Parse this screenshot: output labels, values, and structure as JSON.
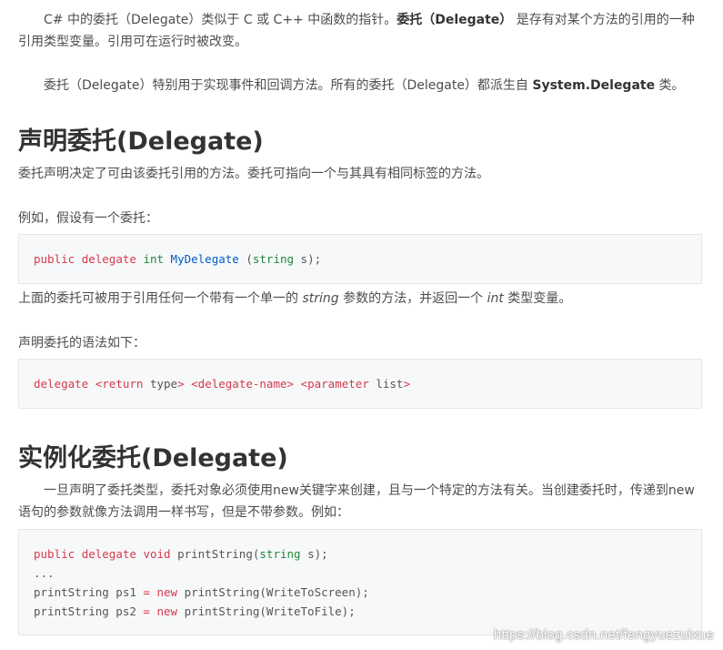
{
  "intro": {
    "p1_a": "C# 中的委托（Delegate）类似于 C 或 C++ 中函数的指针。",
    "p1_bold": "委托（Delegate）",
    "p1_b": " 是存有对某个方法的引用的一种引用类型变量。引用可在运行时被改变。",
    "p2_a": "委托（Delegate）特别用于实现事件和回调方法。所有的委托（Delegate）都派生自 ",
    "p2_bold": "System.Delegate",
    "p2_b": " 类。"
  },
  "declare": {
    "heading": "声明委托(Delegate)",
    "desc": "委托声明决定了可由该委托引用的方法。委托可指向一个与其具有相同标签的方法。",
    "example_intro": "例如，假设有一个委托：",
    "code1": {
      "public": "public",
      "delegate": "delegate",
      "int": "int",
      "name": "MyDelegate",
      "open": " (",
      "string": "string",
      "rest": " s);"
    },
    "above_a": "上面的委托可被用于引用任何一个带有一个单一的 ",
    "above_string": "string",
    "above_b": " 参数的方法，并返回一个 ",
    "above_int": "int",
    "above_c": " 类型变量。",
    "syntax_intro": "声明委托的语法如下：",
    "code2": {
      "delegate": "delegate",
      "return_open": "<return",
      "type": " type",
      "return_close": ">",
      "delegate_name": "<delegate-name>",
      "param_open": "<parameter",
      "param_list": " list",
      "param_close": ">"
    }
  },
  "instantiate": {
    "heading": "实例化委托(Delegate)",
    "desc": "一旦声明了委托类型，委托对象必须使用new关键字来创建，且与一个特定的方法有关。当创建委托时，传递到new语句的参数就像方法调用一样书写，但是不带参数。例如：",
    "code3": {
      "line1_public": "public",
      "line1_delegate": "delegate",
      "line1_void": "void",
      "line1_fn": " printString(",
      "line1_string": "string",
      "line1_rest": " s);",
      "line2": "...",
      "line3_a": "printString ps1 ",
      "line3_eq": "=",
      "line3_new": "new",
      "line3_b": " printString(WriteToScreen);",
      "line4_a": "printString ps2 ",
      "line4_eq": "=",
      "line4_new": "new",
      "line4_b": " printString(WriteToFile);"
    }
  },
  "watermark": "https://blog.csdn.net/fengyuezuixue"
}
